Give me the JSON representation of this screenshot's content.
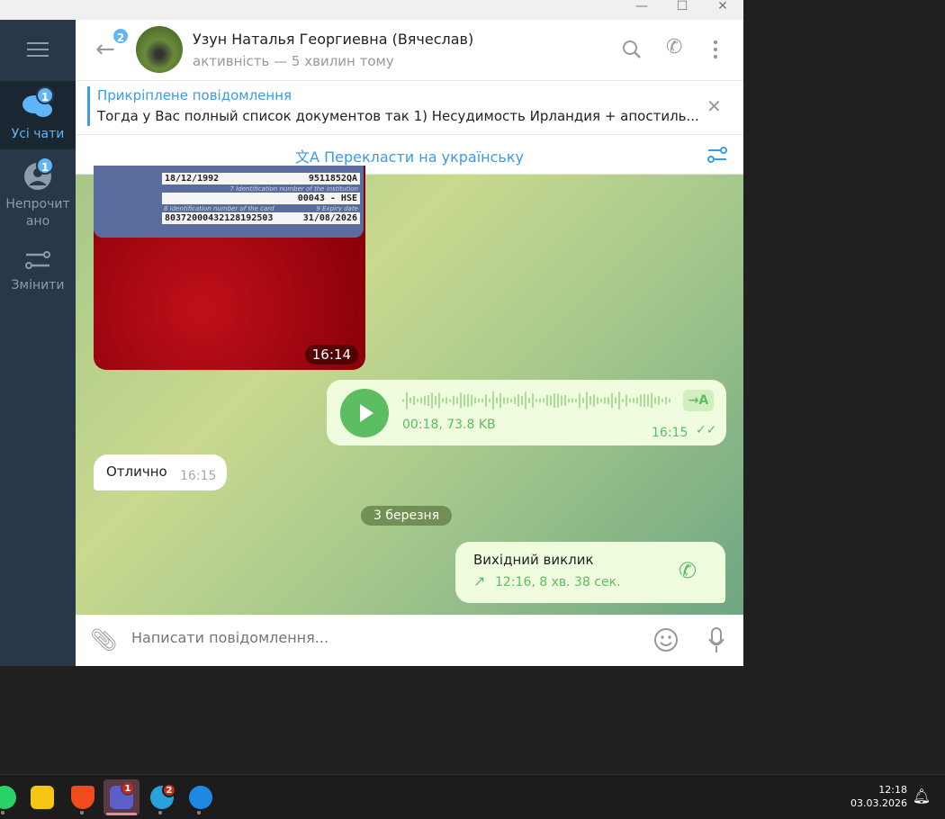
{
  "window": {
    "minimize": "—",
    "maximize": "☐",
    "close": "✕"
  },
  "sidebar": {
    "items": [
      {
        "label": "Усі чати",
        "badge": "1"
      },
      {
        "label": "Непрочит ано",
        "badge": "1"
      },
      {
        "label": "Змінити"
      }
    ]
  },
  "header": {
    "back_badge": "2",
    "name": "Узун Наталья Георгиевна (Вячеслав)",
    "status": "активність — 5 хвилин тому"
  },
  "pinned": {
    "title": "Прикріплене повідомлення",
    "text": "Тогда у Вас полный список документов так  1) Несудимость Ирландия + апостиль..."
  },
  "translate": {
    "label": "Перекласти на українську"
  },
  "messages": {
    "photo": {
      "card_fields": [
        "18/12/1992",
        "9511852QA",
        "00043 - HSE",
        "80372000432128192503",
        "31/08/2026"
      ],
      "card_labels": [
        "7 Identification number of the institution",
        "8 Identification number of the card",
        "9 Expiry date"
      ],
      "time": "16:14"
    },
    "voice": {
      "meta": "00:18, 73.8 KB",
      "time": "16:15",
      "transcribe": "→A"
    },
    "text_in": {
      "text": "Отлично",
      "time": "16:15"
    },
    "date": "3 березня",
    "call": {
      "title": "Вихідний виклик",
      "detail": "12:16, 8 хв. 38 сек."
    }
  },
  "input": {
    "placeholder": "Написати повідомлення..."
  },
  "taskbar": {
    "teams_badge": "1",
    "telegram_badge": "2",
    "time": "12:18",
    "date": "03.03.2026"
  },
  "colors": {
    "accent": "#3a9be6",
    "sidebar": "#283849",
    "outgoing": "#effdde",
    "green": "#5cbd62"
  }
}
